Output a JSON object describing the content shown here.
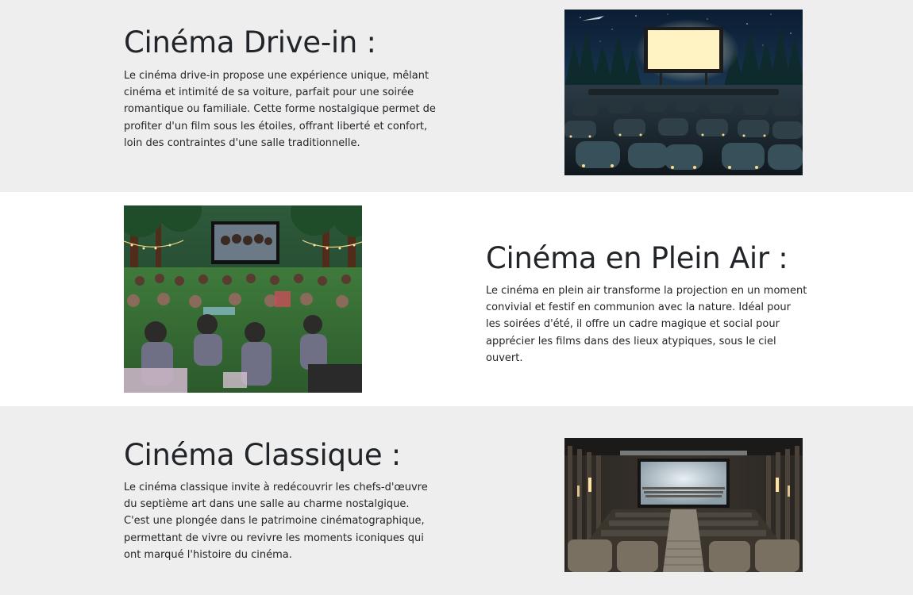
{
  "sections": [
    {
      "title": "Cinéma Drive-in :",
      "description": "Le cinéma drive-in propose une expérience unique, mêlant cinéma et intimité de sa voiture, parfait pour une soirée romantique ou familiale. Cette forme nostalgique permet de profiter d'un film sous les étoiles, offrant liberté et confort, loin des contraintes d'une salle traditionnelle."
    },
    {
      "title": "Cinéma en Plein Air :",
      "description": "Le cinéma en plein air transforme la projection en un moment convivial et festif en communion avec la nature. Idéal pour les soirées d'été, il offre un cadre magique et social pour apprécier les films dans des lieux atypiques, sous le ciel ouvert."
    },
    {
      "title": "Cinéma Classique :",
      "description": "Le cinéma classique invite à redécouvrir les chefs-d'œuvre du septième art dans une salle au charme nostalgique. C'est une plongée dans le patrimoine cinématographique, permettant de vivre ou revivre les moments iconiques qui ont marqué l'histoire du cinéma."
    }
  ],
  "colors": {
    "alt_background": "#eeeeee",
    "text": "#212529"
  }
}
